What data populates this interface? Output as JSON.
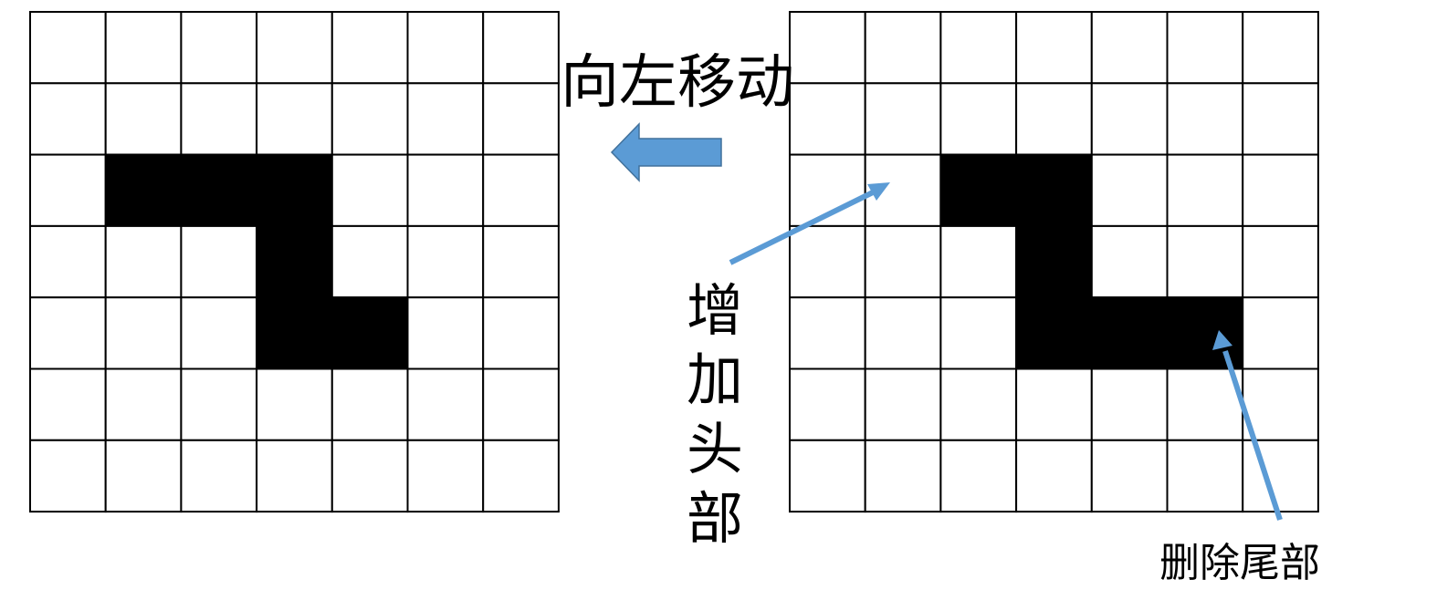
{
  "labels": {
    "move_left": "向左移动",
    "add_head": "增加头部",
    "remove_tail": "删除尾部"
  },
  "grids": {
    "rows": 7,
    "cols": 7,
    "before": {
      "filled": [
        [
          2,
          1
        ],
        [
          2,
          2
        ],
        [
          2,
          3
        ],
        [
          3,
          3
        ],
        [
          4,
          3
        ],
        [
          4,
          4
        ]
      ]
    },
    "after": {
      "filled": [
        [
          2,
          2
        ],
        [
          2,
          3
        ],
        [
          3,
          3
        ],
        [
          4,
          3
        ],
        [
          4,
          4
        ],
        [
          4,
          5
        ]
      ]
    }
  },
  "colors": {
    "arrow": "#5b9bd5",
    "arrow_stroke": "#41719c",
    "filled_cell": "#000000",
    "grid_line": "#000000"
  },
  "icons": {
    "move_arrow": "left-arrow-icon",
    "head_pointer": "pointer-arrow-icon",
    "tail_pointer": "pointer-arrow-icon"
  }
}
